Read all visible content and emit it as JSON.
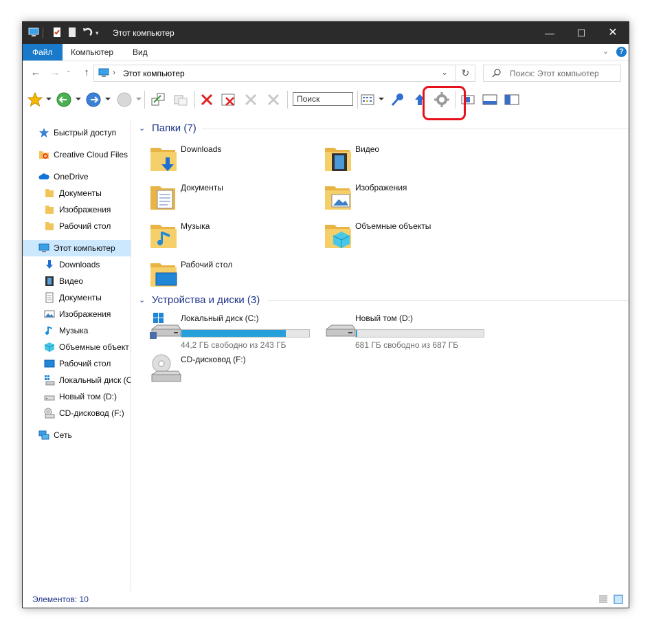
{
  "window": {
    "title": "Этот компьютер"
  },
  "ribbon": {
    "tabs": [
      "Файл",
      "Компьютер",
      "Вид"
    ]
  },
  "address": {
    "path": "Этот компьютер",
    "search_placeholder": "Поиск: Этот компьютер"
  },
  "toolbar": {
    "search_label": "Поиск"
  },
  "sidebar": {
    "items": [
      {
        "label": "Быстрый доступ",
        "icon": "star-icon"
      },
      {
        "label": "Creative Cloud Files",
        "icon": "creative-cloud-icon"
      },
      {
        "label": "OneDrive",
        "icon": "cloud-icon"
      },
      {
        "label": "Документы",
        "icon": "folder-icon"
      },
      {
        "label": "Изображения",
        "icon": "folder-icon"
      },
      {
        "label": "Рабочий стол",
        "icon": "folder-icon"
      },
      {
        "label": "Этот компьютер",
        "icon": "computer-icon"
      },
      {
        "label": "Downloads",
        "icon": "download-arrow-icon"
      },
      {
        "label": "Видео",
        "icon": "film-icon"
      },
      {
        "label": "Документы",
        "icon": "document-icon"
      },
      {
        "label": "Изображения",
        "icon": "picture-icon"
      },
      {
        "label": "Музыка",
        "icon": "music-note-icon"
      },
      {
        "label": "Объемные объект",
        "icon": "cube-icon"
      },
      {
        "label": "Рабочий стол",
        "icon": "desktop-icon"
      },
      {
        "label": "Локальный диск (C",
        "icon": "windows-drive-icon"
      },
      {
        "label": "Новый том (D:)",
        "icon": "drive-icon"
      },
      {
        "label": "CD-дисковод (F:)",
        "icon": "cd-drive-icon"
      },
      {
        "label": "Сеть",
        "icon": "network-icon"
      }
    ]
  },
  "groups": {
    "folders": "Папки (7)",
    "drives": "Устройства и диски (3)"
  },
  "folders": [
    {
      "name": "Downloads",
      "icon": "download-arrow-icon"
    },
    {
      "name": "Видео",
      "icon": "film-icon"
    },
    {
      "name": "Документы",
      "icon": "document-icon"
    },
    {
      "name": "Изображения",
      "icon": "picture-icon"
    },
    {
      "name": "Музыка",
      "icon": "music-note-icon"
    },
    {
      "name": "Объемные объекты",
      "icon": "cube-icon"
    },
    {
      "name": "Рабочий стол",
      "icon": "desktop-icon"
    }
  ],
  "drives": [
    {
      "name": "Локальный диск (C:)",
      "free": "44,2 ГБ свободно из 243 ГБ",
      "used_fraction": 0.818
    },
    {
      "name": "Новый том (D:)",
      "free": "681 ГБ свободно из 687 ГБ",
      "used_fraction": 0.009
    },
    {
      "name": "CD-дисковод (F:)"
    }
  ],
  "status": {
    "count": "Элементов: 10"
  },
  "colors": {
    "accent": "#1979ca",
    "highlight": "#e8101a",
    "drive_fill": "#26a0da",
    "folder": "#f2c55c"
  }
}
